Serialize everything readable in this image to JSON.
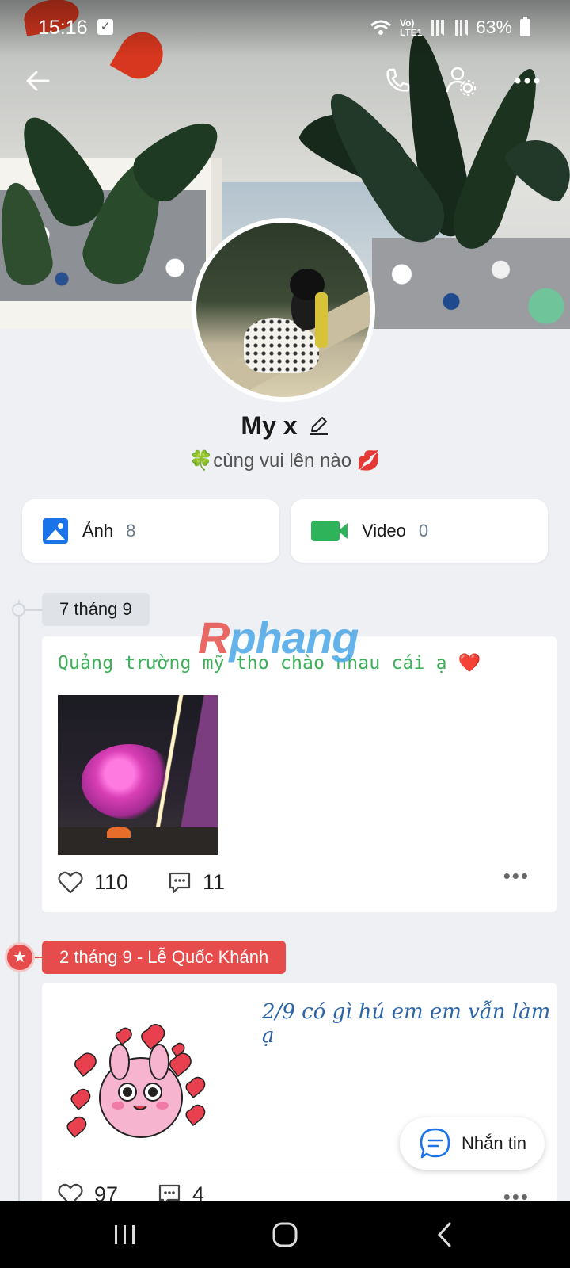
{
  "status_bar": {
    "time": "15:16",
    "network": "Vo) LTE1",
    "battery": "63%"
  },
  "header_actions": {
    "back_icon": "arrow-left-icon",
    "call_icon": "phone-icon",
    "settings_icon": "user-settings-icon",
    "more_icon": "more-horizontal-icon"
  },
  "profile": {
    "name": "My x",
    "status": "cùng vui lên nào",
    "status_prefix_emoji": "🍀",
    "status_suffix_emoji": "💋"
  },
  "media": [
    {
      "label": "Ảnh",
      "count": "8",
      "icon": "photo-icon",
      "color": "#1a73e8"
    },
    {
      "label": "Video",
      "count": "0",
      "icon": "video-icon",
      "color": "#2eb35a"
    }
  ],
  "watermark": {
    "first": "R",
    "rest": "phang"
  },
  "timeline": [
    {
      "date": "7 tháng 9",
      "caption": "Quảng trường mỹ tho chào nhau cái ạ",
      "caption_emoji": "❤️",
      "likes": "110",
      "comments": "11"
    },
    {
      "date": "2 tháng 9 - Lễ Quốc Khánh",
      "caption": "2/9 có gì hú em em vẫn làm ạ",
      "likes": "97",
      "comments": "4"
    }
  ],
  "chat_button": {
    "label": "Nhắn tin"
  },
  "colors": {
    "accent_red": "#e74c4c",
    "caption_green": "#3fae5a",
    "caption_blue": "#2d64a8",
    "background": "#eef0f3"
  }
}
